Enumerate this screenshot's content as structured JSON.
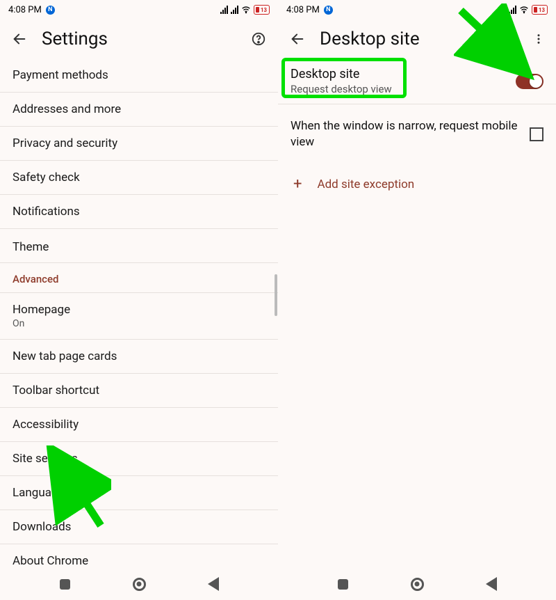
{
  "status": {
    "time": "4:08 PM",
    "battery": "13"
  },
  "left": {
    "title": "Settings",
    "items": [
      {
        "label": "Payment methods"
      },
      {
        "label": "Addresses and more"
      },
      {
        "label": "Privacy and security"
      },
      {
        "label": "Safety check"
      },
      {
        "label": "Notifications"
      },
      {
        "label": "Theme"
      }
    ],
    "advanced_header": "Advanced",
    "advanced": [
      {
        "label": "Homepage",
        "sub": "On"
      },
      {
        "label": "New tab page cards"
      },
      {
        "label": "Toolbar shortcut"
      },
      {
        "label": "Accessibility"
      },
      {
        "label": "Site settings"
      },
      {
        "label": "Languages"
      },
      {
        "label": "Downloads"
      },
      {
        "label": "About Chrome"
      }
    ]
  },
  "right": {
    "title": "Desktop site",
    "desktop": {
      "title": "Desktop site",
      "sub": "Request desktop view",
      "toggle": true
    },
    "narrow": {
      "label": "When the window is narrow, request mobile view",
      "checked": false
    },
    "add_exception": "Add site exception"
  }
}
